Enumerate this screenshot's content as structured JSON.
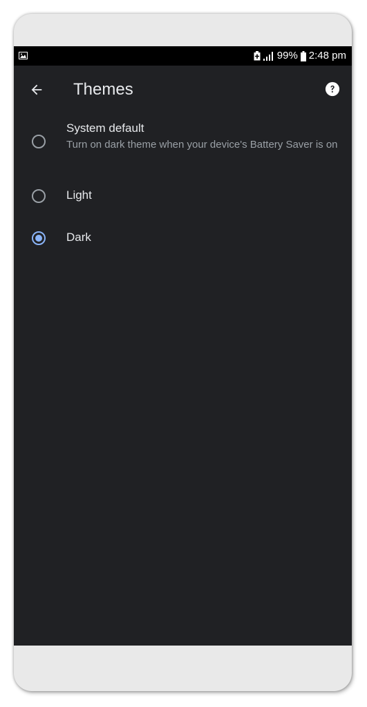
{
  "status_bar": {
    "left_icon": "gallery-notification-icon",
    "battery_saver_icon": "battery-saver-icon",
    "signal_icon": "signal-icon",
    "battery_percent": "99%",
    "battery_icon": "battery-icon",
    "time": "2:48 pm"
  },
  "app_bar": {
    "back_icon": "back-arrow-icon",
    "title": "Themes",
    "help_icon": "help-icon"
  },
  "options": [
    {
      "label": "System default",
      "description": "Turn on dark theme when your device's Battery Saver is on",
      "selected": false
    },
    {
      "label": "Light",
      "selected": false
    },
    {
      "label": "Dark",
      "selected": true
    }
  ],
  "colors": {
    "background": "#202124",
    "text_primary": "#e8eaed",
    "text_secondary": "#9aa0a6",
    "accent": "#8ab4f8",
    "status_bar": "#000000"
  }
}
